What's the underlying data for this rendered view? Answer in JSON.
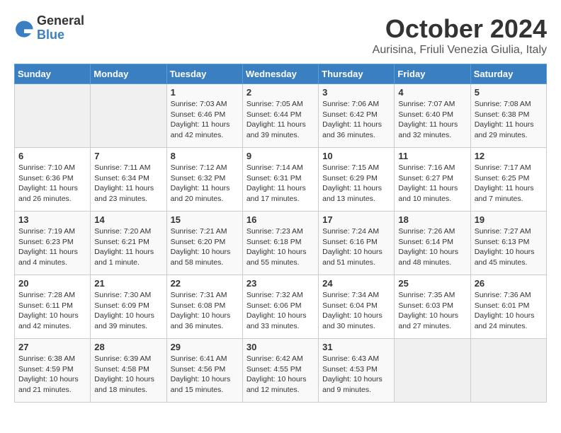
{
  "logo": {
    "general": "General",
    "blue": "Blue"
  },
  "title": "October 2024",
  "location": "Aurisina, Friuli Venezia Giulia, Italy",
  "days_of_week": [
    "Sunday",
    "Monday",
    "Tuesday",
    "Wednesday",
    "Thursday",
    "Friday",
    "Saturday"
  ],
  "weeks": [
    [
      {
        "day": "",
        "sunrise": "",
        "sunset": "",
        "daylight": ""
      },
      {
        "day": "",
        "sunrise": "",
        "sunset": "",
        "daylight": ""
      },
      {
        "day": "1",
        "sunrise": "Sunrise: 7:03 AM",
        "sunset": "Sunset: 6:46 PM",
        "daylight": "Daylight: 11 hours and 42 minutes."
      },
      {
        "day": "2",
        "sunrise": "Sunrise: 7:05 AM",
        "sunset": "Sunset: 6:44 PM",
        "daylight": "Daylight: 11 hours and 39 minutes."
      },
      {
        "day": "3",
        "sunrise": "Sunrise: 7:06 AM",
        "sunset": "Sunset: 6:42 PM",
        "daylight": "Daylight: 11 hours and 36 minutes."
      },
      {
        "day": "4",
        "sunrise": "Sunrise: 7:07 AM",
        "sunset": "Sunset: 6:40 PM",
        "daylight": "Daylight: 11 hours and 32 minutes."
      },
      {
        "day": "5",
        "sunrise": "Sunrise: 7:08 AM",
        "sunset": "Sunset: 6:38 PM",
        "daylight": "Daylight: 11 hours and 29 minutes."
      }
    ],
    [
      {
        "day": "6",
        "sunrise": "Sunrise: 7:10 AM",
        "sunset": "Sunset: 6:36 PM",
        "daylight": "Daylight: 11 hours and 26 minutes."
      },
      {
        "day": "7",
        "sunrise": "Sunrise: 7:11 AM",
        "sunset": "Sunset: 6:34 PM",
        "daylight": "Daylight: 11 hours and 23 minutes."
      },
      {
        "day": "8",
        "sunrise": "Sunrise: 7:12 AM",
        "sunset": "Sunset: 6:32 PM",
        "daylight": "Daylight: 11 hours and 20 minutes."
      },
      {
        "day": "9",
        "sunrise": "Sunrise: 7:14 AM",
        "sunset": "Sunset: 6:31 PM",
        "daylight": "Daylight: 11 hours and 17 minutes."
      },
      {
        "day": "10",
        "sunrise": "Sunrise: 7:15 AM",
        "sunset": "Sunset: 6:29 PM",
        "daylight": "Daylight: 11 hours and 13 minutes."
      },
      {
        "day": "11",
        "sunrise": "Sunrise: 7:16 AM",
        "sunset": "Sunset: 6:27 PM",
        "daylight": "Daylight: 11 hours and 10 minutes."
      },
      {
        "day": "12",
        "sunrise": "Sunrise: 7:17 AM",
        "sunset": "Sunset: 6:25 PM",
        "daylight": "Daylight: 11 hours and 7 minutes."
      }
    ],
    [
      {
        "day": "13",
        "sunrise": "Sunrise: 7:19 AM",
        "sunset": "Sunset: 6:23 PM",
        "daylight": "Daylight: 11 hours and 4 minutes."
      },
      {
        "day": "14",
        "sunrise": "Sunrise: 7:20 AM",
        "sunset": "Sunset: 6:21 PM",
        "daylight": "Daylight: 11 hours and 1 minute."
      },
      {
        "day": "15",
        "sunrise": "Sunrise: 7:21 AM",
        "sunset": "Sunset: 6:20 PM",
        "daylight": "Daylight: 10 hours and 58 minutes."
      },
      {
        "day": "16",
        "sunrise": "Sunrise: 7:23 AM",
        "sunset": "Sunset: 6:18 PM",
        "daylight": "Daylight: 10 hours and 55 minutes."
      },
      {
        "day": "17",
        "sunrise": "Sunrise: 7:24 AM",
        "sunset": "Sunset: 6:16 PM",
        "daylight": "Daylight: 10 hours and 51 minutes."
      },
      {
        "day": "18",
        "sunrise": "Sunrise: 7:26 AM",
        "sunset": "Sunset: 6:14 PM",
        "daylight": "Daylight: 10 hours and 48 minutes."
      },
      {
        "day": "19",
        "sunrise": "Sunrise: 7:27 AM",
        "sunset": "Sunset: 6:13 PM",
        "daylight": "Daylight: 10 hours and 45 minutes."
      }
    ],
    [
      {
        "day": "20",
        "sunrise": "Sunrise: 7:28 AM",
        "sunset": "Sunset: 6:11 PM",
        "daylight": "Daylight: 10 hours and 42 minutes."
      },
      {
        "day": "21",
        "sunrise": "Sunrise: 7:30 AM",
        "sunset": "Sunset: 6:09 PM",
        "daylight": "Daylight: 10 hours and 39 minutes."
      },
      {
        "day": "22",
        "sunrise": "Sunrise: 7:31 AM",
        "sunset": "Sunset: 6:08 PM",
        "daylight": "Daylight: 10 hours and 36 minutes."
      },
      {
        "day": "23",
        "sunrise": "Sunrise: 7:32 AM",
        "sunset": "Sunset: 6:06 PM",
        "daylight": "Daylight: 10 hours and 33 minutes."
      },
      {
        "day": "24",
        "sunrise": "Sunrise: 7:34 AM",
        "sunset": "Sunset: 6:04 PM",
        "daylight": "Daylight: 10 hours and 30 minutes."
      },
      {
        "day": "25",
        "sunrise": "Sunrise: 7:35 AM",
        "sunset": "Sunset: 6:03 PM",
        "daylight": "Daylight: 10 hours and 27 minutes."
      },
      {
        "day": "26",
        "sunrise": "Sunrise: 7:36 AM",
        "sunset": "Sunset: 6:01 PM",
        "daylight": "Daylight: 10 hours and 24 minutes."
      }
    ],
    [
      {
        "day": "27",
        "sunrise": "Sunrise: 6:38 AM",
        "sunset": "Sunset: 4:59 PM",
        "daylight": "Daylight: 10 hours and 21 minutes."
      },
      {
        "day": "28",
        "sunrise": "Sunrise: 6:39 AM",
        "sunset": "Sunset: 4:58 PM",
        "daylight": "Daylight: 10 hours and 18 minutes."
      },
      {
        "day": "29",
        "sunrise": "Sunrise: 6:41 AM",
        "sunset": "Sunset: 4:56 PM",
        "daylight": "Daylight: 10 hours and 15 minutes."
      },
      {
        "day": "30",
        "sunrise": "Sunrise: 6:42 AM",
        "sunset": "Sunset: 4:55 PM",
        "daylight": "Daylight: 10 hours and 12 minutes."
      },
      {
        "day": "31",
        "sunrise": "Sunrise: 6:43 AM",
        "sunset": "Sunset: 4:53 PM",
        "daylight": "Daylight: 10 hours and 9 minutes."
      },
      {
        "day": "",
        "sunrise": "",
        "sunset": "",
        "daylight": ""
      },
      {
        "day": "",
        "sunrise": "",
        "sunset": "",
        "daylight": ""
      }
    ]
  ]
}
